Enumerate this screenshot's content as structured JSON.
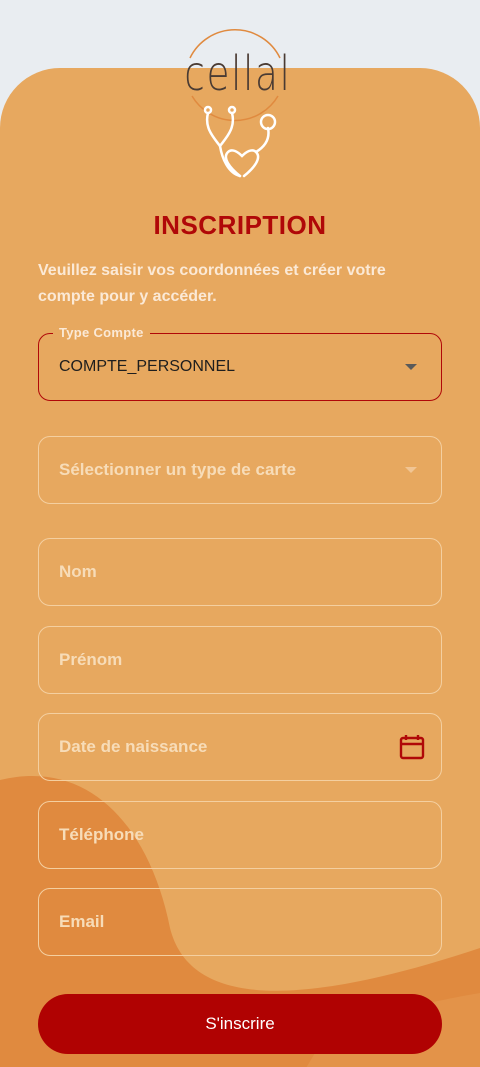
{
  "app": {
    "logo_text": "cellal"
  },
  "form": {
    "title": "INSCRIPTION",
    "subtitle": "Veuillez saisir vos coordonnées et créer votre compte pour y accéder.",
    "account_type": {
      "label": "Type Compte",
      "value": "COMPTE_PERSONNEL"
    },
    "card_type": {
      "placeholder": "Sélectionner un type de carte"
    },
    "last_name": {
      "placeholder": "Nom"
    },
    "first_name": {
      "placeholder": "Prénom"
    },
    "birth_date": {
      "placeholder": "Date de naissance"
    },
    "phone": {
      "placeholder": "Téléphone"
    },
    "email": {
      "placeholder": "Email"
    },
    "submit_label": "S'inscrire"
  },
  "colors": {
    "background": "#e7a85f",
    "accent": "#b00808",
    "button": "#b00202",
    "page_bg": "#e9edf1"
  }
}
